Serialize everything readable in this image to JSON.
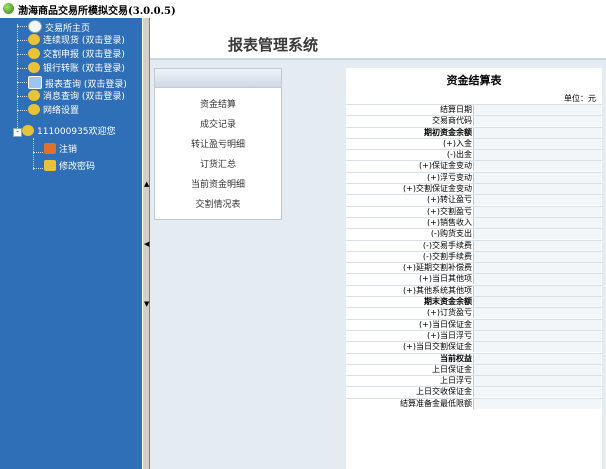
{
  "window": {
    "title": "渤海商品交易所模拟交易(3.0.0.5)"
  },
  "sidebar": {
    "items": [
      {
        "label": "交易所主页",
        "icon": "globe-home-icon",
        "color": "#f6f6f6"
      },
      {
        "label": "连续现货 (双击登录)",
        "icon": "trade-icon",
        "color": "#e8c33a"
      },
      {
        "label": "交割申报 (双击登录)",
        "icon": "trade-icon",
        "color": "#e8c33a"
      },
      {
        "label": "银行转账 (双击登录)",
        "icon": "trade-icon",
        "color": "#e8c33a"
      },
      {
        "label": "报表查询 (双击登录)",
        "icon": "report-icon",
        "color": "#9cc6f0"
      },
      {
        "label": "消息查询 (双击登录)",
        "icon": "trade-icon",
        "color": "#e8c33a"
      },
      {
        "label": "网络设置",
        "icon": "network-icon",
        "color": "#e8c33a"
      },
      {
        "label": "111000935欢迎您",
        "icon": "user-icon",
        "color": "#e8c33a"
      },
      {
        "label": "注销",
        "icon": "logout-icon",
        "color": "#e0702a"
      },
      {
        "label": "修改密码",
        "icon": "password-icon",
        "color": "#e8c33a"
      }
    ]
  },
  "header": {
    "system_name": "报表管理系统"
  },
  "menu": {
    "items": [
      {
        "label": "资金结算"
      },
      {
        "label": "成交记录"
      },
      {
        "label": "转让盈亏明细"
      },
      {
        "label": "订货汇总"
      },
      {
        "label": "当前资金明细"
      },
      {
        "label": "交割情况表"
      }
    ]
  },
  "report": {
    "title": "资金结算表",
    "unit": "单位：元",
    "rows": [
      {
        "label": "结算日期",
        "bold": false
      },
      {
        "label": "交易商代码",
        "bold": false
      },
      {
        "label": "期初资金余额",
        "bold": true
      },
      {
        "label": "(+)入金",
        "bold": false
      },
      {
        "label": "(-)出金",
        "bold": false
      },
      {
        "label": "(+)保证金变动",
        "bold": false
      },
      {
        "label": "(+)浮亏变动",
        "bold": false
      },
      {
        "label": "(+)交割保证金变动",
        "bold": false
      },
      {
        "label": "(+)转让盈亏",
        "bold": false
      },
      {
        "label": "(+)交割盈亏",
        "bold": false
      },
      {
        "label": "(+)销售收入",
        "bold": false
      },
      {
        "label": "(-)购货支出",
        "bold": false
      },
      {
        "label": "(-)交易手续费",
        "bold": false
      },
      {
        "label": "(-)交割手续费",
        "bold": false
      },
      {
        "label": "(+)延期交割补偿费",
        "bold": false
      },
      {
        "label": "(+)当日其他项",
        "bold": false
      },
      {
        "label": "(+)其他系统其他项",
        "bold": false
      },
      {
        "label": "期末资金余额",
        "bold": true
      },
      {
        "label": "(+)订货盈亏",
        "bold": false
      },
      {
        "label": "(+)当日保证金",
        "bold": false
      },
      {
        "label": "(+)当日浮亏",
        "bold": false
      },
      {
        "label": "(+)当日交割保证金",
        "bold": false
      },
      {
        "label": "当前权益",
        "bold": true
      },
      {
        "label": "上日保证金",
        "bold": false
      },
      {
        "label": "上日浮亏",
        "bold": false
      },
      {
        "label": "上日交收保证金",
        "bold": false
      },
      {
        "label": "结算准备金最低限额",
        "bold": false
      }
    ]
  }
}
